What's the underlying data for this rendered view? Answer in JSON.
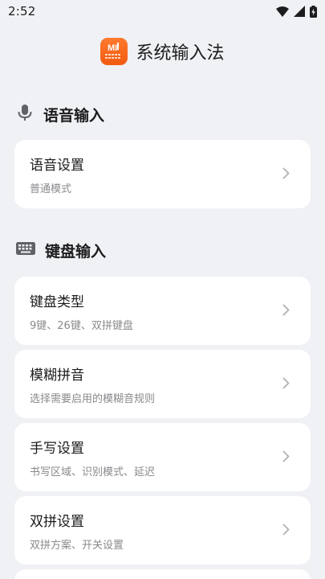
{
  "status_bar": {
    "time": "2:52",
    "icons": [
      "wifi-icon",
      "cell-signal-icon",
      "battery-charging-icon"
    ]
  },
  "app": {
    "title": "系统输入法",
    "logo_text": "MI",
    "logo_icon": "keyboard-logo-icon",
    "accent_color": "#f5661c"
  },
  "sections": {
    "voice": {
      "title": "语音输入",
      "icon": "microphone-icon",
      "items": [
        {
          "title": "语音设置",
          "subtitle": "普通模式"
        }
      ]
    },
    "keyboard": {
      "title": "键盘输入",
      "icon": "keyboard-icon",
      "items": [
        {
          "title": "键盘类型",
          "subtitle": "9键、26键、双拼键盘"
        },
        {
          "title": "模糊拼音",
          "subtitle": "选择需要启用的模糊音规则"
        },
        {
          "title": "手写设置",
          "subtitle": "书写区域、识别模式、延迟"
        },
        {
          "title": "双拼设置",
          "subtitle": "双拼方案、开关设置"
        }
      ]
    }
  },
  "colors": {
    "background": "#f0f1f5",
    "card": "#ffffff",
    "subtitle": "#8a8a8e",
    "chevron": "#b0b0b5"
  }
}
